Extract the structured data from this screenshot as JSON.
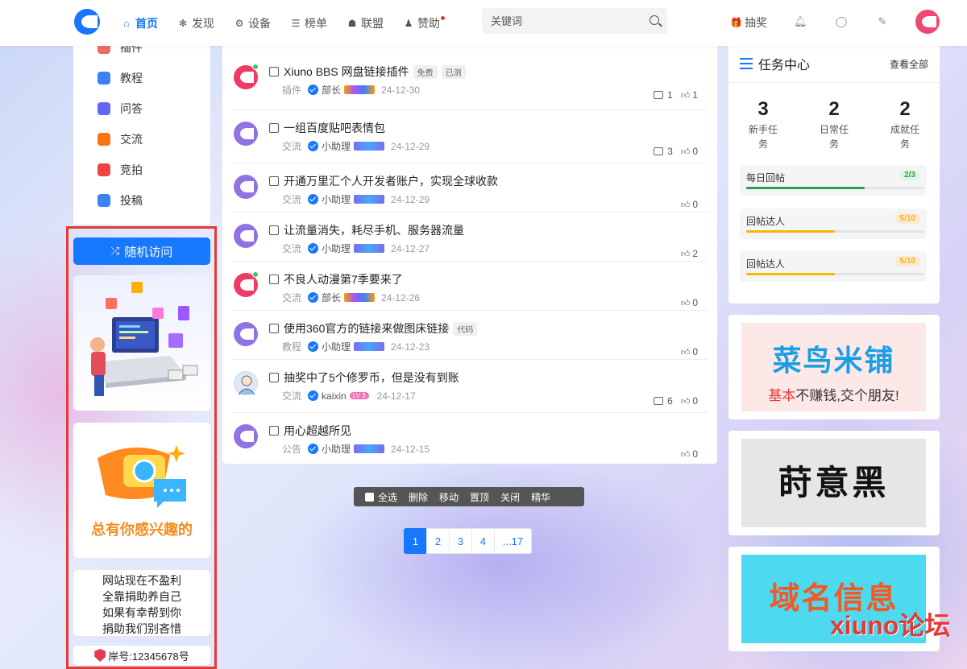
{
  "header": {
    "nav": [
      {
        "icon": "home-icon",
        "label": "首页",
        "active": true
      },
      {
        "icon": "discover-icon",
        "label": "发现"
      },
      {
        "icon": "device-icon",
        "label": "设备"
      },
      {
        "icon": "ranking-icon",
        "label": "榜单"
      },
      {
        "icon": "alliance-icon",
        "label": "联盟"
      },
      {
        "icon": "sponsor-icon",
        "label": "赞助"
      }
    ],
    "search_placeholder": "关键词",
    "lottery_label": "抽奖"
  },
  "left_menu": [
    {
      "label": "插件",
      "icon": "plugin-icon",
      "color": "#f06a6a"
    },
    {
      "label": "教程",
      "icon": "tutorial-icon",
      "color": "#3b82f6"
    },
    {
      "label": "问答",
      "icon": "question-icon",
      "color": "#6366f1"
    },
    {
      "label": "交流",
      "icon": "exchange-icon",
      "color": "#f97316"
    },
    {
      "label": "竞拍",
      "icon": "auction-icon",
      "color": "#ef4444"
    },
    {
      "label": "投稿",
      "icon": "submit-icon",
      "color": "#3b82f6"
    }
  ],
  "random_visit_label": "随机访问",
  "left_card2_text": "总有你感兴趣的",
  "left_card3_lines": [
    "网站现在不盈利",
    "全靠捐助养自己",
    "如果有幸帮到你",
    "捐助我们别吝惜"
  ],
  "left_card4_text": "岸号:12345678号",
  "posts": [
    {
      "title": "Xiuno BBS 网盘链接插件",
      "tags": [
        "免费",
        "已测"
      ],
      "category": "插件",
      "author": "部长",
      "rank": "gold",
      "date": "24-12-30",
      "comments": "1",
      "likes": "1",
      "avatar": "red",
      "online": true
    },
    {
      "title": "一组百度贴吧表情包",
      "tags": [],
      "category": "交流",
      "author": "小助理",
      "rank": "blue",
      "date": "24-12-29",
      "comments": "3",
      "likes": "0",
      "avatar": "purple"
    },
    {
      "title": "开通万里汇个人开发者账户，实现全球收款",
      "tags": [],
      "category": "交流",
      "author": "小助理",
      "rank": "blue",
      "date": "24-12-29",
      "comments": "",
      "likes": "0",
      "avatar": "purple"
    },
    {
      "title": "让流量消失，耗尽手机、服务器流量",
      "tags": [],
      "category": "交流",
      "author": "小助理",
      "rank": "blue",
      "date": "24-12-27",
      "comments": "",
      "likes": "2",
      "avatar": "purple"
    },
    {
      "title": "不良人动漫第7季要来了",
      "tags": [],
      "category": "交流",
      "author": "部长",
      "rank": "gold",
      "date": "24-12-26",
      "comments": "",
      "likes": "0",
      "avatar": "red",
      "online": true
    },
    {
      "title": "使用360官方的链接来做图床链接",
      "tags": [
        "代码"
      ],
      "category": "教程",
      "author": "小助理",
      "rank": "blue",
      "date": "24-12-23",
      "comments": "",
      "likes": "0",
      "avatar": "purple"
    },
    {
      "title": "抽奖中了5个修罗币，但是没有到账",
      "tags": [],
      "category": "交流",
      "author": "kaixin",
      "rank": "lv",
      "lv": "LV 3",
      "date": "24-12-17",
      "comments": "6",
      "likes": "0",
      "avatar": "user"
    },
    {
      "title": "用心超越所见",
      "tags": [],
      "category": "公告",
      "author": "小助理",
      "rank": "blue",
      "date": "24-12-15",
      "comments": "",
      "likes": "0",
      "avatar": "purple"
    }
  ],
  "action_bar": [
    "全选",
    "删除",
    "移动",
    "置顶",
    "关闭",
    "精华"
  ],
  "pagination": [
    "1",
    "2",
    "3",
    "4",
    "...17"
  ],
  "task_center": {
    "title": "任务中心",
    "view_all": "查看全部",
    "stats": [
      {
        "num": "3",
        "label_1": "新手任",
        "label_2": "务"
      },
      {
        "num": "2",
        "label_1": "日常任",
        "label_2": "务"
      },
      {
        "num": "2",
        "label_1": "成就任",
        "label_2": "务"
      }
    ],
    "tasks": [
      {
        "name": "每日回帖",
        "progress": "2/3",
        "fraction": 0.667,
        "color": "#2e9e4a",
        "badge_bg": "#dff5e2"
      },
      {
        "name": "回帖达人",
        "progress": "5/10",
        "fraction": 0.5,
        "color": "#f5b800",
        "badge_bg": "#fde8d7"
      },
      {
        "name": "回帖达人",
        "progress": "5/10",
        "fraction": 0.5,
        "color": "#f5b800",
        "badge_bg": "#fde8d7"
      }
    ]
  },
  "ads": {
    "ad1_big": "菜鸟米铺",
    "ad1_small_red": "基本",
    "ad1_small_rest": "不赚钱,交个朋友!",
    "ad2_text": "莳意黑",
    "ad3_text": "域名信息"
  },
  "watermark": "xiuno论坛"
}
